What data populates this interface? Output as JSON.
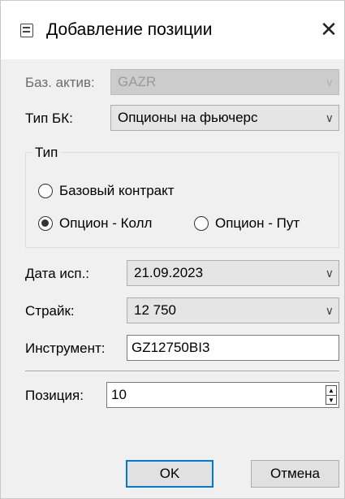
{
  "window": {
    "title": "Добавление позиции",
    "icon": "calculator-icon",
    "close_glyph": "✕"
  },
  "form": {
    "base_asset": {
      "label": "Баз. актив:",
      "value": "GAZR",
      "disabled": true
    },
    "bk_type": {
      "label": "Тип БК:",
      "value": "Опционы на фьючерс"
    },
    "type_group": {
      "title": "Тип",
      "options": [
        {
          "label": "Базовый контракт",
          "checked": false
        },
        {
          "label": "Опцион - Колл",
          "checked": true
        },
        {
          "label": "Опцион - Пут",
          "checked": false
        }
      ]
    },
    "expiry": {
      "label": "Дата исп.:",
      "value": "21.09.2023"
    },
    "strike": {
      "label": "Страйк:",
      "value": "12 750"
    },
    "instrument": {
      "label": "Инструмент:",
      "value": "GZ12750BI3"
    },
    "position": {
      "label": "Позиция:",
      "value": "10"
    }
  },
  "buttons": {
    "ok": "OK",
    "cancel": "Отмена"
  },
  "colors": {
    "accent": "#0078d7",
    "dialog_bg": "#f0f0f0"
  }
}
